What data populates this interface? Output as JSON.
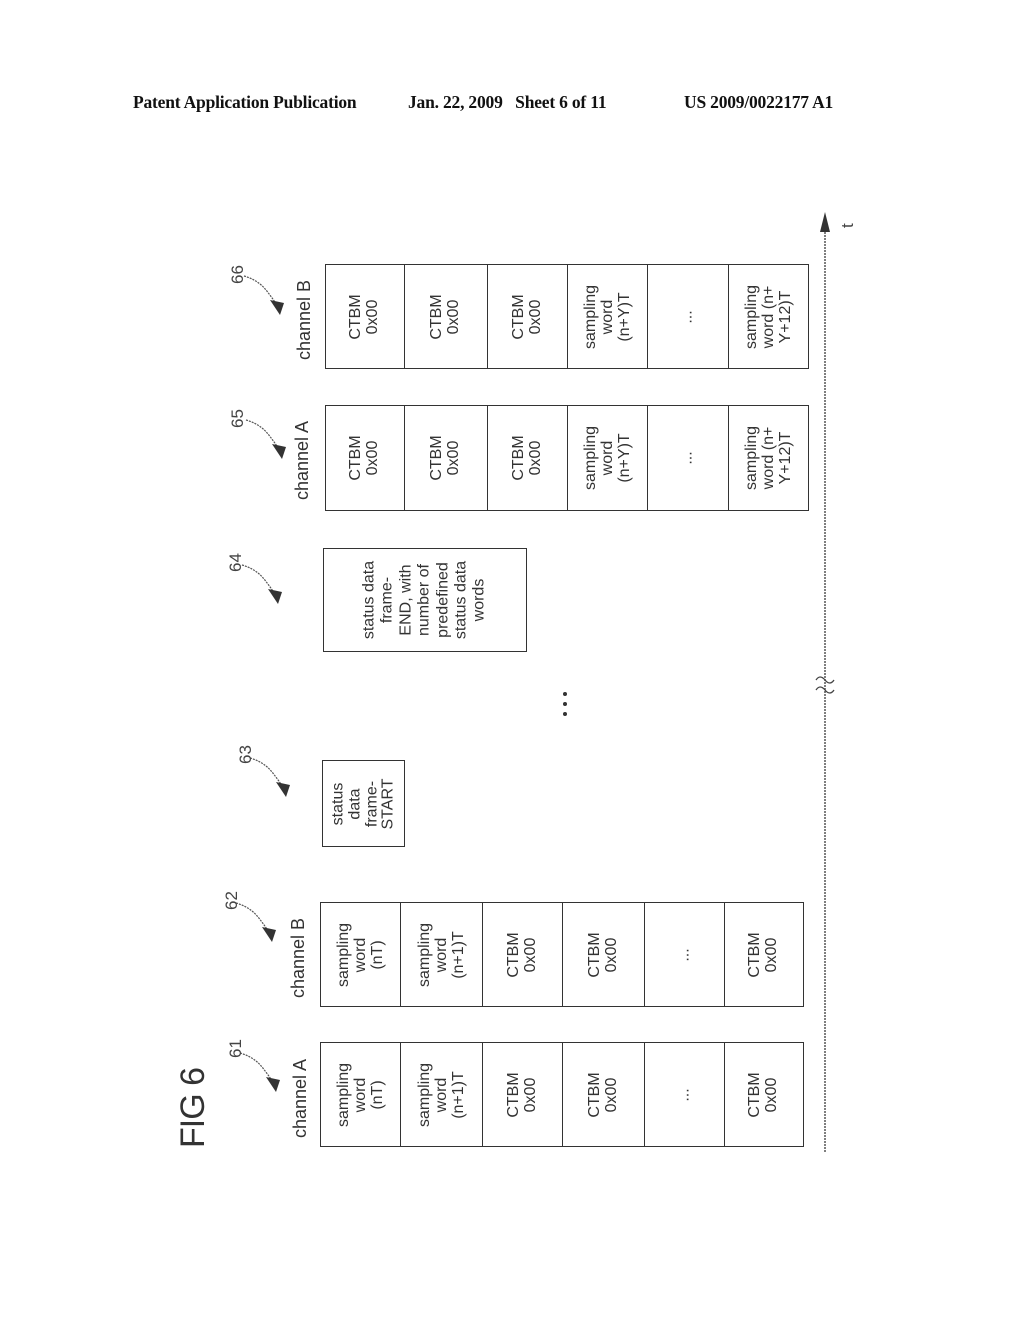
{
  "header": {
    "publication": "Patent Application Publication",
    "date_sheet": "Jan. 22, 2009   Sheet 6 of 11",
    "number": "US 2009/0022177 A1"
  },
  "figure": {
    "title": "FIG 6",
    "time_axis_label": "t",
    "middle_ellipsis": "...",
    "groups": [
      {
        "ref": "61",
        "label": "channel A",
        "cells": [
          "sampling\nword\n(nT)",
          "sampling\nword\n(n+1)T",
          "CTBM\n0x00",
          "CTBM\n0x00",
          "...",
          "CTBM\n0x00"
        ]
      },
      {
        "ref": "62",
        "label": "channel B",
        "cells": [
          "sampling\nword\n(nT)",
          "sampling\nword\n(n+1)T",
          "CTBM\n0x00",
          "CTBM\n0x00",
          "...",
          "CTBM\n0x00"
        ]
      },
      {
        "ref": "63",
        "label": "",
        "cells": [
          "status data\nframe-\nSTART"
        ]
      },
      {
        "ref": "64",
        "label": "",
        "cells": [
          "status data\nframe-\nEND, with\nnumber of\npredefined\nstatus data\nwords"
        ]
      },
      {
        "ref": "65",
        "label": "channel A",
        "cells": [
          "CTBM\n0x00",
          "CTBM\n0x00",
          "CTBM\n0x00",
          "sampling\nword\n(n+Y)T",
          "...",
          "sampling\nword (n+\nY+12)T"
        ]
      },
      {
        "ref": "66",
        "label": "channel B",
        "cells": [
          "CTBM\n0x00",
          "CTBM\n0x00",
          "CTBM\n0x00",
          "sampling\nword\n(n+Y)T",
          "...",
          "sampling\nword (n+\nY+12)T"
        ]
      }
    ]
  }
}
